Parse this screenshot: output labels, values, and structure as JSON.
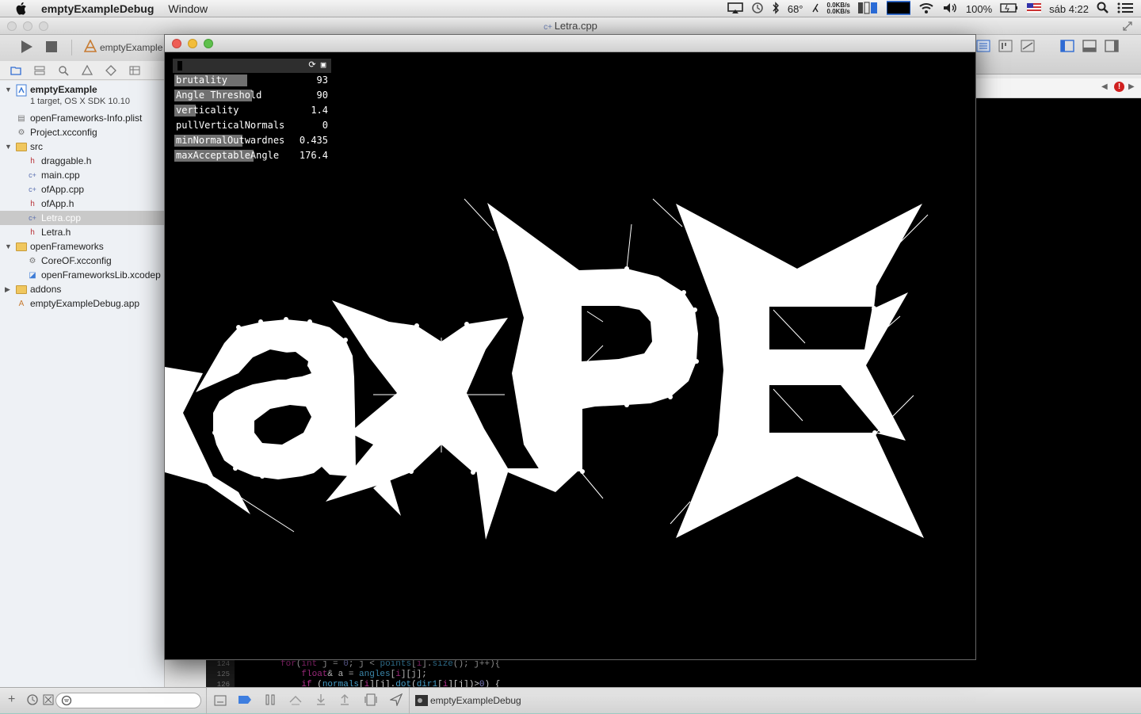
{
  "menubar": {
    "app_name": "emptyExampleDebug",
    "menus": [
      "Window"
    ],
    "status": {
      "temperature": "68°",
      "net_up": "0.0KB/s",
      "net_down": "0.0KB/s",
      "battery": "100%",
      "clock": "sáb 4:22"
    }
  },
  "xcode": {
    "title": "Letra.cpp",
    "scheme": "emptyExample",
    "project": {
      "name": "emptyExample",
      "subtitle": "1 target, OS X SDK 10.10"
    },
    "tree": [
      {
        "label": "openFrameworks-Info.plist",
        "indent": 1,
        "icon": "plist"
      },
      {
        "label": "Project.xcconfig",
        "indent": 1,
        "icon": "config"
      },
      {
        "label": "src",
        "indent": 1,
        "icon": "folder",
        "open": true
      },
      {
        "label": "draggable.h",
        "indent": 2,
        "icon": "h"
      },
      {
        "label": "main.cpp",
        "indent": 2,
        "icon": "cpp"
      },
      {
        "label": "ofApp.cpp",
        "indent": 2,
        "icon": "cpp"
      },
      {
        "label": "ofApp.h",
        "indent": 2,
        "icon": "h"
      },
      {
        "label": "Letra.cpp",
        "indent": 2,
        "icon": "cpp",
        "selected": true
      },
      {
        "label": "Letra.h",
        "indent": 2,
        "icon": "h"
      },
      {
        "label": "openFrameworks",
        "indent": 1,
        "icon": "folder",
        "open": true
      },
      {
        "label": "CoreOF.xcconfig",
        "indent": 2,
        "icon": "config"
      },
      {
        "label": "openFrameworksLib.xcodep",
        "indent": 2,
        "icon": "xcodeproj"
      },
      {
        "label": "addons",
        "indent": 1,
        "icon": "folder",
        "open": false
      },
      {
        "label": "emptyExampleDebug.app",
        "indent": 1,
        "icon": "app"
      }
    ],
    "code": {
      "line_numbers": [
        "124",
        "125",
        "126"
      ],
      "lines": [
        "for(int j = 0; j < points[i].size(); j++){",
        "    float& a = angles[i][j];",
        "    if (normals[i][j].dot(dir1[i][j])>0) {"
      ]
    },
    "debug_target": "emptyExampleDebug"
  },
  "gui": {
    "params": [
      {
        "label": "brutality",
        "value": "93",
        "fill": 0.47
      },
      {
        "label": "Angle Threshold",
        "value": "90",
        "fill": 0.5
      },
      {
        "label": "verticality",
        "value": "1.4",
        "fill": 0.14
      },
      {
        "label": "pullVerticalNormals",
        "value": "0",
        "fill": 0
      },
      {
        "label": "minNormalOutwardnes",
        "value": "0.435",
        "fill": 0.44
      },
      {
        "label": "maxAcceptableAngle",
        "value": "176.4",
        "fill": 0.51
      }
    ]
  },
  "colors": {
    "selection": "#c9c9c9",
    "error_badge": "#d0201f",
    "close": "#ee5d55",
    "minimize": "#f2bd3a",
    "zoom": "#5fc04d"
  }
}
